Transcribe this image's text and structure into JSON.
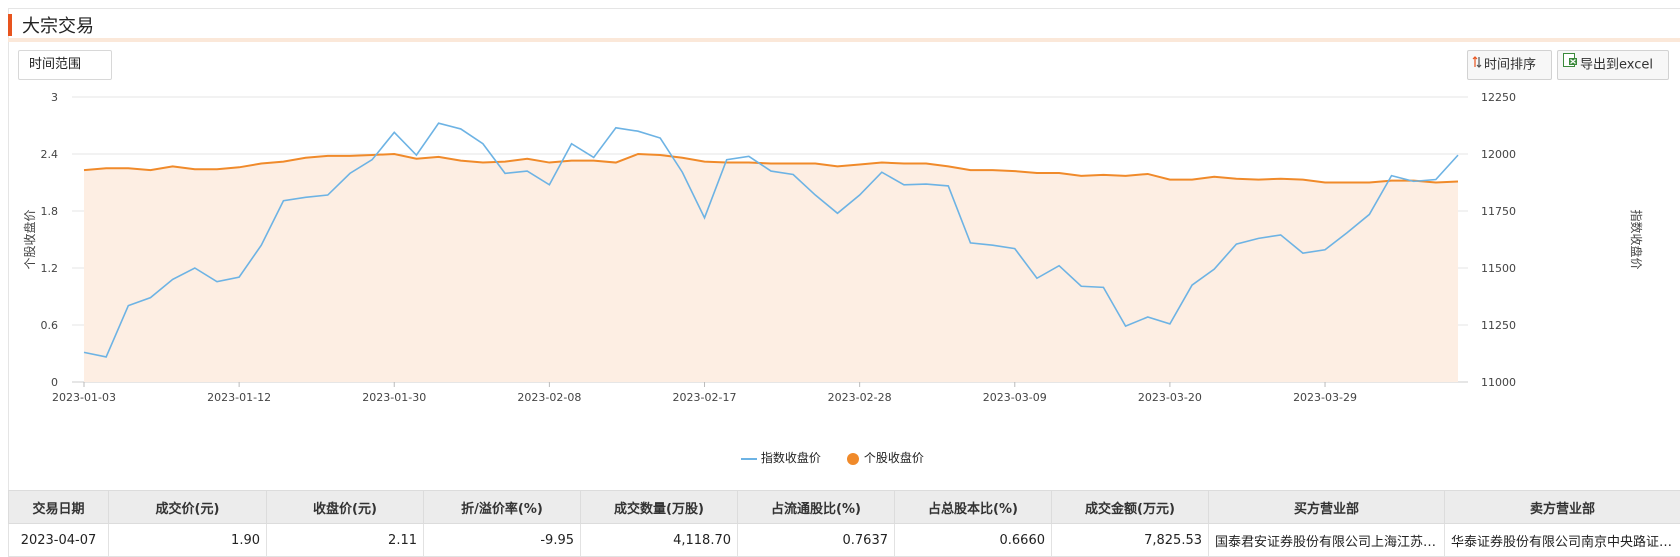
{
  "header": {
    "title": "大宗交易"
  },
  "toolbar": {
    "range_label": "时间范围",
    "sort_label": "时间排序",
    "export_label": "导出到excel"
  },
  "colors": {
    "accent": "#e8541e",
    "index_line": "#6db3e4",
    "stock_line": "#f08a2a",
    "area_fill": "#fdeee3"
  },
  "chart_data": {
    "type": "line",
    "x": [
      "2023-01-03",
      "2023-01-04",
      "2023-01-05",
      "2023-01-06",
      "2023-01-09",
      "2023-01-10",
      "2023-01-11",
      "2023-01-12",
      "2023-01-13",
      "2023-01-16",
      "2023-01-17",
      "2023-01-18",
      "2023-01-19",
      "2023-01-20",
      "2023-01-30",
      "2023-01-31",
      "2023-02-01",
      "2023-02-02",
      "2023-02-03",
      "2023-02-06",
      "2023-02-07",
      "2023-02-08",
      "2023-02-09",
      "2023-02-10",
      "2023-02-13",
      "2023-02-14",
      "2023-02-15",
      "2023-02-16",
      "2023-02-17",
      "2023-02-20",
      "2023-02-21",
      "2023-02-22",
      "2023-02-23",
      "2023-02-24",
      "2023-02-27",
      "2023-02-28",
      "2023-03-01",
      "2023-03-02",
      "2023-03-03",
      "2023-03-06",
      "2023-03-07",
      "2023-03-08",
      "2023-03-09",
      "2023-03-10",
      "2023-03-13",
      "2023-03-14",
      "2023-03-15",
      "2023-03-16",
      "2023-03-17",
      "2023-03-20",
      "2023-03-21",
      "2023-03-22",
      "2023-03-23",
      "2023-03-24",
      "2023-03-27",
      "2023-03-28",
      "2023-03-29",
      "2023-03-30",
      "2023-03-31",
      "2023-04-03",
      "2023-04-04",
      "2023-04-06",
      "2023-04-07"
    ],
    "x_tick_labels": [
      "2023-01-03",
      "2023-01-12",
      "2023-01-30",
      "2023-02-08",
      "2023-02-17",
      "2023-02-28",
      "2023-03-09",
      "2023-03-20",
      "2023-03-29"
    ],
    "series": [
      {
        "name": "个股收盘价",
        "axis": "left",
        "area": true,
        "values": [
          2.23,
          2.25,
          2.25,
          2.23,
          2.27,
          2.24,
          2.24,
          2.26,
          2.3,
          2.32,
          2.36,
          2.38,
          2.38,
          2.39,
          2.4,
          2.35,
          2.37,
          2.33,
          2.31,
          2.32,
          2.35,
          2.31,
          2.33,
          2.33,
          2.31,
          2.4,
          2.39,
          2.36,
          2.32,
          2.31,
          2.31,
          2.3,
          2.3,
          2.3,
          2.27,
          2.29,
          2.31,
          2.3,
          2.3,
          2.27,
          2.23,
          2.23,
          2.22,
          2.2,
          2.2,
          2.17,
          2.18,
          2.17,
          2.19,
          2.13,
          2.13,
          2.16,
          2.14,
          2.13,
          2.14,
          2.13,
          2.1,
          2.1,
          2.1,
          2.12,
          2.12,
          2.1,
          2.11
        ]
      },
      {
        "name": "指数收盘价",
        "axis": "right",
        "values": [
          11130,
          11110,
          11335,
          11370,
          11450,
          11500,
          11440,
          11460,
          11600,
          11795,
          11810,
          11820,
          11915,
          11975,
          12095,
          11995,
          12135,
          12110,
          12045,
          11915,
          11925,
          11865,
          12045,
          11985,
          12115,
          12100,
          12070,
          11920,
          11720,
          11975,
          11990,
          11925,
          11910,
          11820,
          11740,
          11820,
          11920,
          11865,
          11868,
          11860,
          11610,
          11600,
          11585,
          11455,
          11510,
          11420,
          11415,
          11245,
          11285,
          11255,
          11425,
          11495,
          11605,
          11630,
          11645,
          11565,
          11580,
          11655,
          11735,
          11905,
          11880,
          11888,
          11995
        ]
      }
    ],
    "y_left": {
      "label": "个股收盘价",
      "ticks": [
        "0",
        "0.6",
        "1.2",
        "1.8",
        "2.4",
        "3"
      ],
      "ylim": [
        0,
        3
      ]
    },
    "y_right": {
      "label": "指数收盘价",
      "ticks": [
        "11000",
        "11250",
        "11500",
        "11750",
        "12000",
        "12250"
      ],
      "ylim": [
        11000,
        12250
      ]
    },
    "grid": true,
    "legend_position": "bottom-center",
    "legend": [
      "指数收盘价",
      "个股收盘价"
    ]
  },
  "table": {
    "headers": [
      "交易日期",
      "成交价(元)",
      "收盘价(元)",
      "折/溢价率(%)",
      "成交数量(万股)",
      "占流通股比(%)",
      "占总股本比(%)",
      "成交金额(万元)",
      "买方营业部",
      "卖方营业部"
    ],
    "rows": [
      [
        "2023-04-07",
        "1.90",
        "2.11",
        "-9.95",
        "4,118.70",
        "0.7637",
        "0.6660",
        "7,825.53",
        "国泰君安证券股份有限公司上海江苏路证券营业部",
        "华泰证券股份有限公司南京中央路证券营业部"
      ]
    ]
  }
}
